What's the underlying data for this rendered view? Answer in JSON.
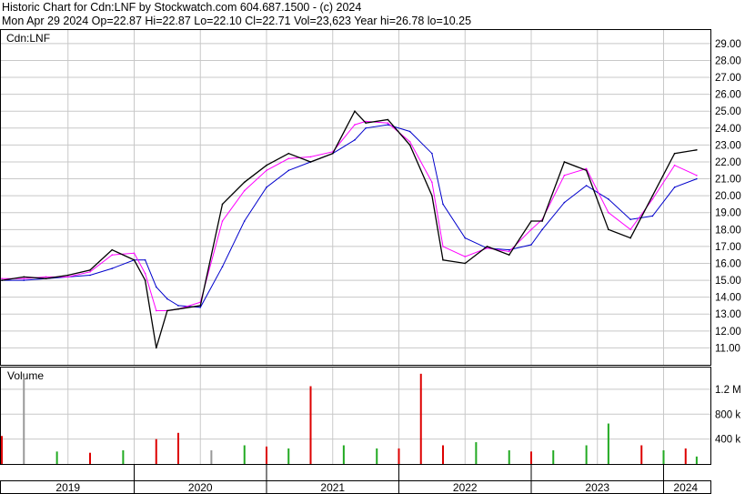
{
  "header": {
    "line1": "Historic Chart for Cdn:LNF by Stockwatch.com 604.687.1500 - (c) 2024",
    "line2": "Mon Apr 29 2024  Op=22.87  Hi=22.87  Lo=22.10  Cl=22.71  Vol=23,623  Year hi=26.78  lo=10.25"
  },
  "colors": {
    "price": "#000000",
    "ma_short": "#ff00ff",
    "ma_long": "#0000cc",
    "vol_up": "#22aa22",
    "vol_down": "#dd0000",
    "vol_flat": "#999999",
    "grid": "#c8c8c8"
  },
  "chart_data": [
    {
      "type": "line",
      "panel": "price",
      "symbol_label": "Cdn:LNF",
      "x_range": [
        "2019-01",
        "2024-04"
      ],
      "y_range": [
        10,
        29.8
      ],
      "y_ticks": [
        "11.00",
        "12.00",
        "13.00",
        "14.00",
        "15.00",
        "16.00",
        "17.00",
        "18.00",
        "19.00",
        "20.00",
        "21.00",
        "22.00",
        "23.00",
        "24.00",
        "25.00",
        "26.00",
        "27.00",
        "28.00",
        "29.00"
      ],
      "grid": true,
      "x": [
        "2019-01",
        "2019-03",
        "2019-05",
        "2019-07",
        "2019-09",
        "2019-11",
        "2020-01",
        "2020-02",
        "2020-03",
        "2020-04",
        "2020-05",
        "2020-07",
        "2020-09",
        "2020-11",
        "2021-01",
        "2021-03",
        "2021-05",
        "2021-07",
        "2021-09",
        "2021-10",
        "2021-12",
        "2022-02",
        "2022-04",
        "2022-05",
        "2022-07",
        "2022-09",
        "2022-11",
        "2023-01",
        "2023-02",
        "2023-04",
        "2023-06",
        "2023-08",
        "2023-10",
        "2023-12",
        "2024-02",
        "2024-04"
      ],
      "series": [
        {
          "role": "price",
          "values": [
            15.0,
            15.2,
            15.1,
            15.3,
            15.6,
            16.8,
            16.2,
            15.0,
            11.0,
            13.2,
            13.3,
            13.5,
            19.5,
            20.8,
            21.8,
            22.5,
            22.0,
            22.5,
            25.0,
            24.3,
            24.5,
            23.0,
            20.0,
            16.2,
            16.0,
            17.0,
            16.5,
            18.5,
            18.5,
            22.0,
            21.5,
            18.0,
            17.5,
            20.0,
            22.5,
            22.71
          ]
        },
        {
          "role": "ma_short",
          "values": [
            15.1,
            15.1,
            15.2,
            15.2,
            15.5,
            16.5,
            16.6,
            15.4,
            13.2,
            13.2,
            13.3,
            13.7,
            18.5,
            20.3,
            21.5,
            22.2,
            22.3,
            22.6,
            24.2,
            24.4,
            24.3,
            23.2,
            20.8,
            17.0,
            16.4,
            16.9,
            16.7,
            18.0,
            18.6,
            21.2,
            21.6,
            19.0,
            18.0,
            19.8,
            21.8,
            21.2
          ]
        },
        {
          "role": "ma_long",
          "values": [
            15.0,
            15.0,
            15.1,
            15.2,
            15.3,
            15.7,
            16.2,
            16.2,
            14.6,
            13.9,
            13.5,
            13.4,
            15.8,
            18.5,
            20.5,
            21.5,
            22.0,
            22.5,
            23.3,
            24.0,
            24.2,
            23.8,
            22.5,
            19.5,
            17.5,
            16.9,
            16.8,
            17.1,
            18.0,
            19.6,
            20.6,
            19.8,
            18.6,
            18.8,
            20.5,
            21.0
          ]
        }
      ]
    },
    {
      "type": "bar",
      "panel": "volume",
      "title": "Volume",
      "y_range": [
        0,
        1.55
      ],
      "y_ticks": [
        "400 k",
        "800 k",
        "1.2 M"
      ],
      "tick_values": [
        0.4,
        0.8,
        1.2
      ],
      "x_labels": [
        "2019",
        "2020",
        "2021",
        "2022",
        "2023",
        "2024"
      ],
      "x": [
        "2019-01",
        "2019-03",
        "2019-06",
        "2019-09",
        "2019-12",
        "2020-03",
        "2020-05",
        "2020-08",
        "2020-11",
        "2021-01",
        "2021-03",
        "2021-05",
        "2021-08",
        "2021-11",
        "2022-01",
        "2022-03",
        "2022-05",
        "2022-08",
        "2022-11",
        "2023-01",
        "2023-03",
        "2023-06",
        "2023-08",
        "2023-11",
        "2024-01",
        "2024-03",
        "2024-04"
      ],
      "values": [
        0.45,
        1.4,
        0.2,
        0.18,
        0.22,
        0.4,
        0.5,
        0.22,
        0.3,
        0.28,
        0.25,
        1.25,
        0.3,
        0.25,
        0.25,
        1.45,
        0.3,
        0.35,
        0.22,
        0.2,
        0.22,
        0.3,
        0.65,
        0.3,
        0.22,
        0.25,
        0.12
      ],
      "directions": [
        "down",
        "flat",
        "up",
        "down",
        "up",
        "down",
        "down",
        "flat",
        "up",
        "down",
        "up",
        "down",
        "up",
        "up",
        "down",
        "down",
        "down",
        "up",
        "up",
        "down",
        "up",
        "up",
        "up",
        "down",
        "up",
        "down",
        "up"
      ]
    }
  ]
}
